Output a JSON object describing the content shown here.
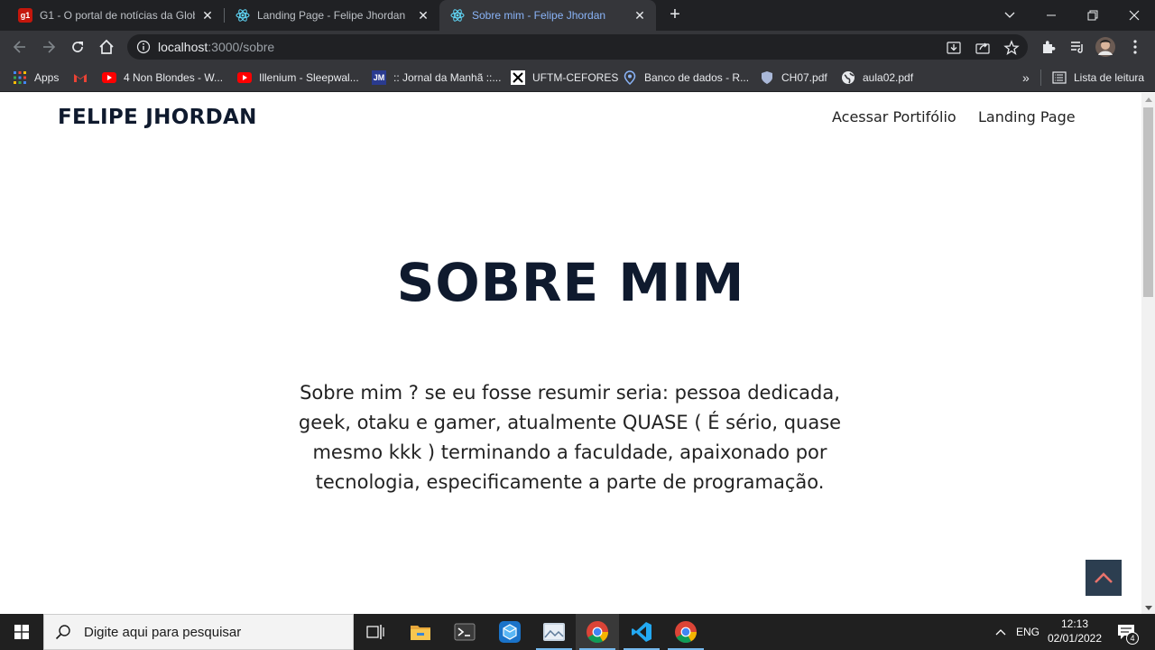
{
  "browser": {
    "tabs": [
      {
        "title": "G1 - O portal de notícias da Glob",
        "favicon": "g1-icon",
        "favicon_text": "g1",
        "active": false
      },
      {
        "title": "Landing Page - Felipe Jhordan",
        "favicon": "react-icon",
        "active": false
      },
      {
        "title": "Sobre mim - Felipe Jhordan",
        "favicon": "react-icon",
        "active": true
      }
    ],
    "url_host": "localhost",
    "url_path": ":3000/sobre",
    "bookmarks": [
      {
        "label": "Apps",
        "icon": "apps-grid-icon"
      },
      {
        "label": "",
        "icon": "gmail-icon"
      },
      {
        "label": "4 Non Blondes - W...",
        "icon": "youtube-icon"
      },
      {
        "label": "Illenium - Sleepwal...",
        "icon": "youtube-icon"
      },
      {
        "label": ":: Jornal da Manhã ::...",
        "icon": "jm-icon",
        "icon_text": "JM"
      },
      {
        "label": "UFTM-CEFORES",
        "icon": "uftm-icon"
      },
      {
        "label": "Banco de dados - R...",
        "icon": "map-pin-icon"
      },
      {
        "label": "CH07.pdf",
        "icon": "shield-icon"
      },
      {
        "label": "aula02.pdf",
        "icon": "globe-icon"
      }
    ],
    "reading_list": "Lista de leitura"
  },
  "site": {
    "brand": "FELIPE JHORDAN",
    "nav": [
      "Acessar Portifólio",
      "Landing Page"
    ],
    "hero_title": "SOBRE MIM",
    "hero_text": "Sobre mim ? se eu fosse resumir seria: pessoa dedicada, geek, otaku e gamer, atualmente QUASE ( É sério, quase mesmo kkk ) terminando a faculdade, apaixonado por tecnologia, especificamente a parte de programação."
  },
  "taskbar": {
    "search_placeholder": "Digite aqui para pesquisar",
    "language": "ENG",
    "time": "12:13",
    "date": "02/01/2022",
    "notification_count": "4"
  },
  "colors": {
    "brand_navy": "#0f1a2e",
    "active_tab_text": "#8ab4f8",
    "back_to_top": "#2c3e50",
    "back_to_top_arrow": "#e8736c"
  }
}
